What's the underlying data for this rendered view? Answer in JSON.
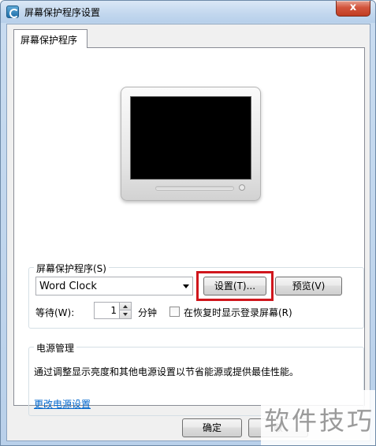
{
  "window": {
    "title": "屏幕保护程序设置",
    "close_symbol": "x"
  },
  "tab": {
    "label": "屏幕保护程序"
  },
  "screensaver": {
    "group_label": "屏幕保护程序(S)",
    "selected": "Word Clock",
    "settings_label": "设置(T)...",
    "preview_label": "预览(V)",
    "wait_label": "等待(W):",
    "wait_value": "1",
    "minutes_label": "分钟",
    "resume_checkbox_label": "在恢复时显示登录屏幕(R)",
    "resume_checked": false
  },
  "power": {
    "group_label": "电源管理",
    "description": "通过调整显示亮度和其他电源设置以节省能源或提供最佳性能。",
    "link": "更改电源设置"
  },
  "footer": {
    "ok_label": "确定",
    "cancel_label_partial": "取"
  },
  "watermark": "软件技巧",
  "colors": {
    "highlight": "#d0161c",
    "link": "#0066cc",
    "close_button": "#c13d22"
  },
  "icons": [
    "app-icon",
    "chevron-down-icon",
    "spin-up-icon",
    "spin-down-icon",
    "monitor-icon"
  ]
}
